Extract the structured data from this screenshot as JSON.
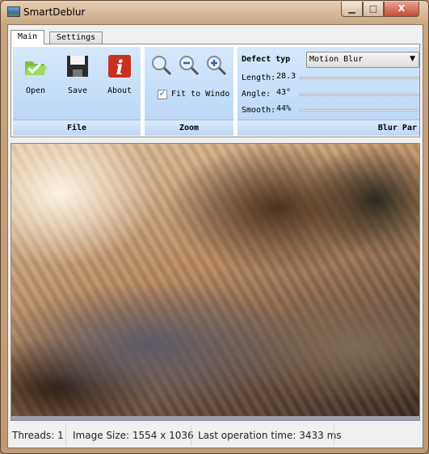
{
  "window": {
    "title": "SmartDeblur",
    "close": "X"
  },
  "tabs": [
    {
      "label": "Main"
    },
    {
      "label": "Settings"
    }
  ],
  "file_group": {
    "label": "File",
    "buttons": [
      {
        "label": "Open",
        "icon": "open-folder-icon"
      },
      {
        "label": "Save",
        "icon": "floppy-save-icon"
      },
      {
        "label": "About",
        "icon": "info-icon"
      }
    ]
  },
  "zoom_group": {
    "label": "Zoom",
    "fit_label": "Fit to Windo",
    "fit_checked": true
  },
  "blur_group": {
    "label": "Blur Par",
    "defect_label": "Defect typ",
    "defect_value": "Motion Blur",
    "length_label": "Length:",
    "length_value": "28.3",
    "angle_label": "Angle:",
    "angle_value": "43°",
    "smooth_label": "Smooth:",
    "smooth_value": "44%"
  },
  "status": {
    "threads": "Threads: 1",
    "image_size": "Image Size: 1554 x 1036",
    "last_op": "Last operation time: 3433 ms"
  }
}
